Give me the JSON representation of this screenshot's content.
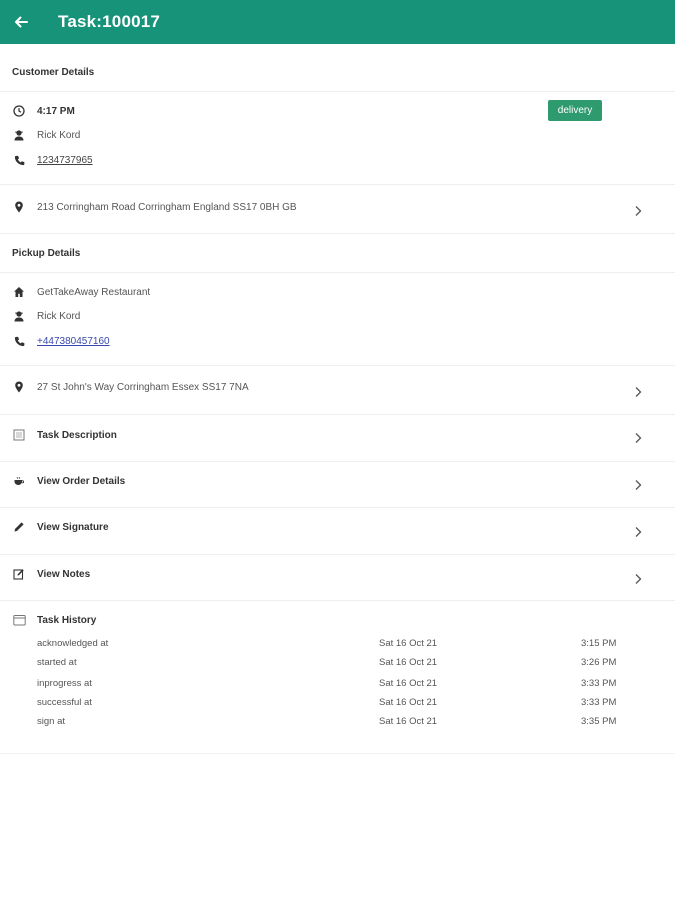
{
  "header": {
    "title": "Task:100017",
    "back_icon": "arrow-left-icon",
    "background": "#17937a"
  },
  "customer": {
    "section_title": "Customer Details",
    "time": "4:17 PM",
    "badge": "delivery",
    "badge_color": "#2e9b6f",
    "name": "Rick Kord",
    "phone": "1234737965",
    "address": "213 Corringham Road Corringham England SS17 0BH GB"
  },
  "pickup": {
    "section_title": "Pickup Details",
    "place": "GetTakeAway Restaurant",
    "name": "Rick Kord",
    "phone": "+447380457160",
    "address": "27 St John's Way Corringham Essex SS17 7NA"
  },
  "menu": {
    "task_description": "Task Description",
    "view_order_details": "View Order Details",
    "view_signature": "View Signature",
    "view_notes": "View Notes"
  },
  "history": {
    "title": "Task History",
    "rows": [
      {
        "label": "acknowledged at",
        "date": "Sat 16 Oct 21",
        "time": "3:15 PM"
      },
      {
        "label": "started at",
        "date": "Sat 16 Oct 21",
        "time": "3:26 PM"
      },
      {
        "label": "inprogress at",
        "date": "Sat 16 Oct 21",
        "time": "3:33 PM"
      },
      {
        "label": "successful at",
        "date": "Sat 16 Oct 21",
        "time": "3:33 PM"
      },
      {
        "label": "sign at",
        "date": "Sat 16 Oct 21",
        "time": "3:35 PM"
      }
    ]
  }
}
